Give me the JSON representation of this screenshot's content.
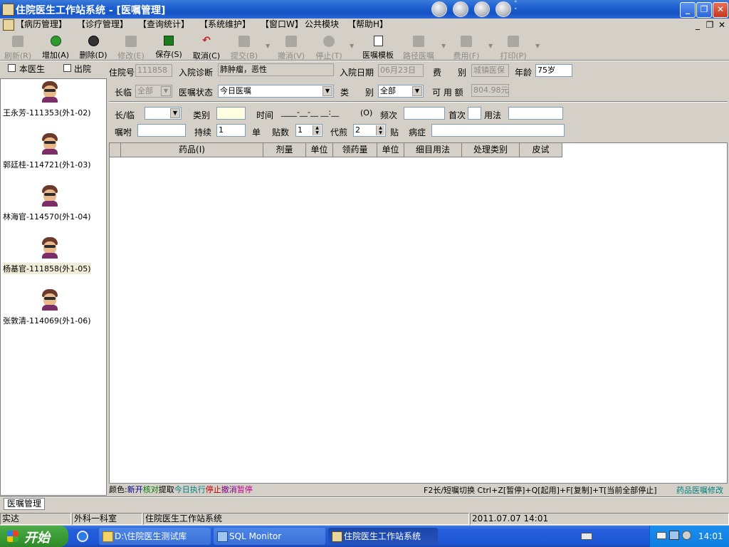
{
  "window": {
    "title": "住院医生工作站系统 - [医嘱管理]",
    "minimize_glyph": "_",
    "restore_glyph": "❐",
    "close_glyph": "✕",
    "mdi_minimize": "_",
    "mdi_restore": "❐",
    "mdi_close": "✕"
  },
  "menu": [
    "【病历管理】",
    "【诊疗管理】",
    "【查询统计】",
    "【系统维护】",
    "【窗口W】",
    "公共模块",
    "【帮助H】"
  ],
  "toolbar": [
    {
      "label": "刷新(R)",
      "icon": "refresh-icon",
      "enabled": false
    },
    {
      "label": "增加(A)",
      "icon": "add-icon",
      "enabled": true
    },
    {
      "label": "删除(D)",
      "icon": "delete-icon",
      "enabled": true
    },
    {
      "label": "修改(E)",
      "icon": "edit-icon",
      "enabled": false
    },
    {
      "label": "保存(S)",
      "icon": "save-icon",
      "enabled": true
    },
    {
      "label": "取消(C)",
      "icon": "undo-icon",
      "enabled": true
    },
    {
      "label": "提交(B)",
      "icon": "submit-icon",
      "enabled": false
    },
    {
      "label": "撤消(V)",
      "icon": "revoke-icon",
      "enabled": false
    },
    {
      "label": "停止(T)",
      "icon": "stop-icon",
      "enabled": false
    },
    {
      "label": "医嘱模板",
      "icon": "template-icon",
      "enabled": true
    },
    {
      "label": "路径医嘱",
      "icon": "path-icon",
      "enabled": false
    },
    {
      "label": "费用(F)",
      "icon": "fee-icon",
      "enabled": false
    },
    {
      "label": "打印(P)",
      "icon": "print-icon",
      "enabled": false
    }
  ],
  "filters": {
    "my_doctor_label": "本医生",
    "discharged_label": "出院"
  },
  "patients": [
    {
      "name": "王永芳-111353(外1-02)",
      "selected": false
    },
    {
      "name": "郭廷桂-114721(外1-03)",
      "selected": false
    },
    {
      "name": "林海官-114570(外1-04)",
      "selected": false
    },
    {
      "name": "杨基官-111858(外1-05)",
      "selected": true
    },
    {
      "name": "张敦清-114069(外1-06)",
      "selected": false
    }
  ],
  "patient_info": {
    "admission_no_label": "住院号",
    "admission_no": "111858",
    "diagnosis_label": "入院诊断",
    "diagnosis": "肺肿瘤，恶性",
    "admission_date_label": "入院日期",
    "admission_date": "06月23日",
    "fee_label": "费",
    "type_label": "别",
    "fee_type": "城镇医保",
    "age_label": "年龄",
    "age": "75岁",
    "longtemp_label": "长临",
    "longtemp": "全部",
    "order_status_label": "医嘱状态",
    "order_status": "今日医嘱",
    "category_label_1": "类",
    "category_label_2": "别",
    "category": "全部",
    "available_label": "可 用 额",
    "available": "804.98元"
  },
  "order_entry": {
    "longtemp_label": "长/临",
    "category_label": "类别",
    "time_label": "时间",
    "time_value": "____-__-__ __:__",
    "time_hint": "(O)",
    "freq_label": "频次",
    "first_label": "首次",
    "usage_label": "用法",
    "instruction_label": "嘱咐",
    "duration_label": "持续",
    "duration": "1",
    "unit_label": "单",
    "plaster_label": "贴数",
    "plaster": "1",
    "decoct_label": "代煎",
    "decoct": "2",
    "decoct_unit": "贴",
    "symptom_label": "病症"
  },
  "grid": {
    "columns": [
      "",
      "药品(I)",
      "剂量",
      "单位",
      "领药量",
      "单位",
      "细目用法",
      "处理类别",
      "皮试"
    ]
  },
  "legend": {
    "prefix": "颜色:",
    "items": [
      {
        "text": "新开",
        "color": "#000080"
      },
      {
        "text": "核对",
        "color": "#008000"
      },
      {
        "text": "提取",
        "color": "#000000"
      },
      {
        "text": "今日执行",
        "color": "#008080"
      },
      {
        "text": "停止",
        "color": "#c00000"
      },
      {
        "text": "撤消",
        "color": "#800080"
      },
      {
        "text": "暂停",
        "color": "#c0008c"
      }
    ],
    "shortcuts": "F2长/短嘱切换 Ctrl+Z[暂停]+Q[起用]+F[复制]+T[当前全部停止]",
    "modify_link": "药品医嘱修改",
    "modify_color": "#008080"
  },
  "bottom_tab": "医嘱管理",
  "statusbar": {
    "user": "实达",
    "dept": "外科一科室",
    "system": "住院医生工作站系统",
    "datetime": "2011.07.07 14:01"
  },
  "taskbar": {
    "start": "开始",
    "tasks": [
      {
        "label": "D:\\住院医生测试库",
        "active": false
      },
      {
        "label": "SQL Monitor",
        "active": false
      },
      {
        "label": "住院医生工作站系统",
        "active": true
      }
    ],
    "clock": "14:01"
  }
}
